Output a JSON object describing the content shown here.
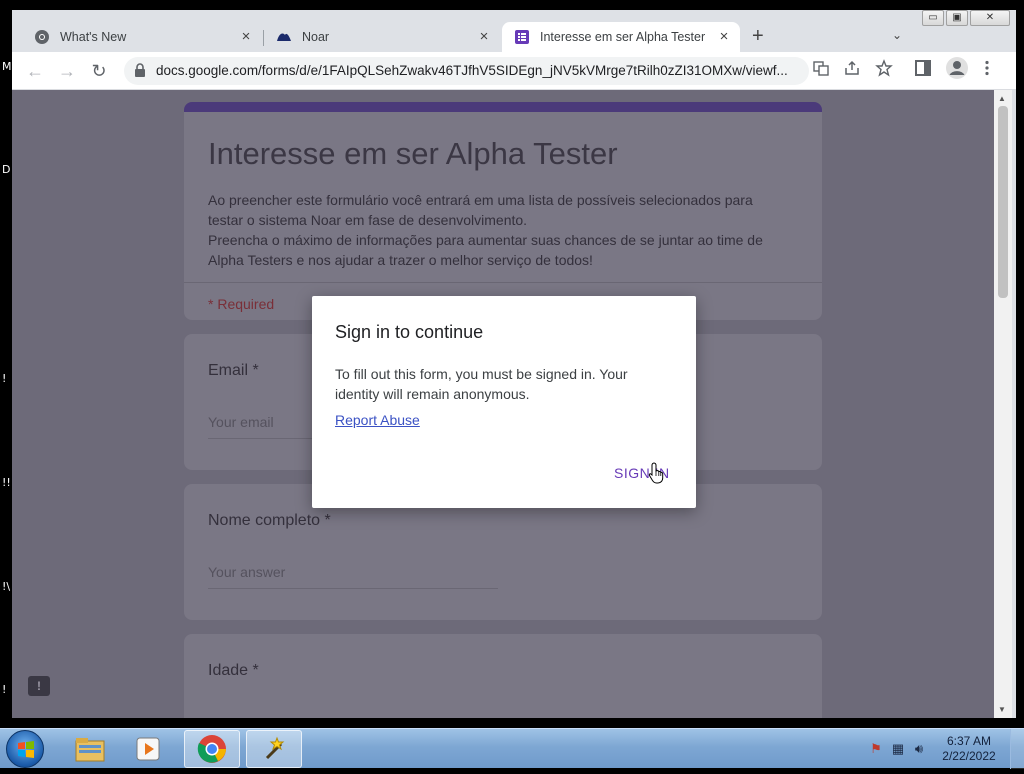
{
  "desktop": {
    "edge_glyphs": [
      "M",
      "D",
      "!",
      "!!",
      "!\\",
      "!"
    ]
  },
  "browser": {
    "window_controls": {
      "minimize": "▭",
      "maximize": "▣",
      "close": "✕"
    },
    "tabs": [
      {
        "title": "What's New",
        "icon": "chrome-icon",
        "active": false
      },
      {
        "title": "Noar",
        "icon": "noar-icon",
        "active": false
      },
      {
        "title": "Interesse em ser Alpha Tester",
        "icon": "google-forms-icon",
        "active": true
      }
    ],
    "new_tab": "+",
    "tab_search": "⌄",
    "address": "docs.google.com/forms/d/e/1FAIpQLSehZwakv46TJfhV5SIDEgn_jNV5kVMrge7tRilh0zZI31OMXw/viewf...",
    "nav": {
      "back": "←",
      "forward": "→",
      "reload": "↻"
    },
    "toolbar_icons": [
      "translate-icon",
      "share-icon",
      "star-icon",
      "side-panel-icon",
      "profile-icon",
      "menu-icon"
    ]
  },
  "form": {
    "title": "Interesse em ser Alpha Tester",
    "description": "Ao preencher este formulário você entrará em uma lista de possíveis selecionados para\ntestar o sistema Noar em fase de desenvolvimento.\nPreencha o máximo de informações para aumentar suas chances de se juntar ao time de\nAlpha Testers e nos ajudar a trazer o melhor serviço de todos!",
    "required_note": "* Required",
    "questions": [
      {
        "label": "Email *",
        "placeholder": "Your email"
      },
      {
        "label": "Nome completo *",
        "placeholder": "Your answer"
      },
      {
        "label": "Idade *",
        "placeholder": ""
      }
    ],
    "feedback_icon": "!"
  },
  "dialog": {
    "title": "Sign in to continue",
    "body": "To fill out this form, you must be signed in. Your identity will remain anonymous.",
    "link": "Report Abuse",
    "button": "SIGN IN"
  },
  "taskbar": {
    "items": [
      "windows-explorer",
      "media-player",
      "chrome",
      "magic-wand-app"
    ],
    "clock_time": "6:37 AM",
    "clock_date": "2/22/2022"
  },
  "colors": {
    "forms_accent": "#673ab7",
    "overlay": "#6d6a79"
  }
}
